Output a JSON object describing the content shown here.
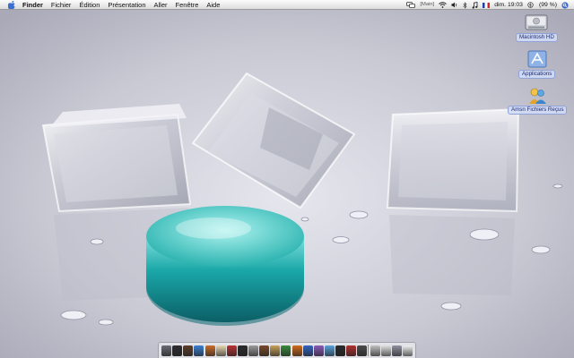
{
  "menubar": {
    "app_name": "Finder",
    "items": [
      "Fichier",
      "Édition",
      "Présentation",
      "Aller",
      "Fenêtre",
      "Aide"
    ],
    "extras": {
      "main_badge": "[Main]",
      "clock": "dim. 19:03",
      "battery": "(99 %)"
    }
  },
  "desktop_icons": [
    {
      "label": "Macintosh HD",
      "icon": "hard-drive-icon"
    },
    {
      "label": "Applications",
      "icon": "applications-folder-icon"
    },
    {
      "label": "Amsn Fichiers Reçus",
      "icon": "amsn-icon"
    }
  ],
  "dock": {
    "colors": [
      "#6b6b74",
      "#2d2d32",
      "#5a3f2a",
      "#3b7fd0",
      "#c86d2a",
      "#e7d7b0",
      "#b83232",
      "#2a2a2a",
      "#9a9a9a",
      "#7a4a2a",
      "#c8a15a",
      "#3a8a3a",
      "#d06b1a",
      "#3363c0",
      "#8a5ab8",
      "#5aa0d8",
      "#2a2a2a",
      "#b03030",
      "#4a4a4a",
      "#c0c0c0",
      "#e0e0e0",
      "#9090a0",
      "#f0f0f0"
    ]
  },
  "colors": {
    "menubar_bg": "#e9e9e9",
    "label_bg": "#d2dcf5",
    "teal_disc": "#2aa6a6"
  }
}
